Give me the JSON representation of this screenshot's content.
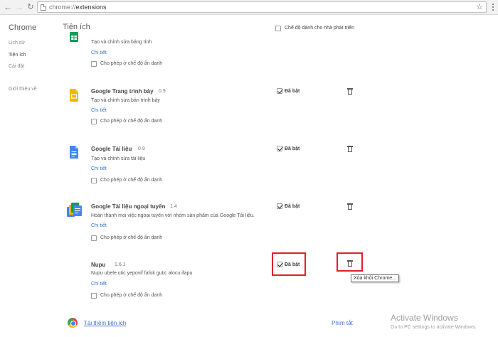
{
  "browser": {
    "url_scheme": "chrome://",
    "url_path": "extensions"
  },
  "sidebar": {
    "title": "Chrome",
    "items": [
      {
        "label": "Lịch sử"
      },
      {
        "label": "Tiện ích"
      },
      {
        "label": "Cài đặt"
      },
      {
        "label": "Giới thiệu về"
      }
    ]
  },
  "header": {
    "title": "Tiện ích",
    "dev_mode_label": "Chế độ dành cho nhà phát triển"
  },
  "extensions": [
    {
      "name": "",
      "version": "",
      "description": "Tạo và chỉnh sửa bảng tính",
      "details": "Chi tiết",
      "incognito": "Cho phép ở chế độ ẩn danh",
      "icon": "google-sheets-icon"
    },
    {
      "name": "Google Trang trình bày",
      "version": "0.9",
      "description": "Tạo và chỉnh sửa bản trình bày",
      "details": "Chi tiết",
      "incognito": "Cho phép ở chế độ ẩn danh",
      "enabled_label": "Đã bật",
      "icon": "google-slides-icon"
    },
    {
      "name": "Google Tài liệu",
      "version": "0.9",
      "description": "Tạo và chỉnh sửa tài liệu",
      "details": "Chi tiết",
      "incognito": "Cho phép ở chế độ ẩn danh",
      "enabled_label": "Đã bật",
      "icon": "google-docs-icon"
    },
    {
      "name": "Google Tài liệu ngoại tuyến",
      "version": "1.4",
      "description": "Hoàn thành mọi việc ngoại tuyến với nhóm sản phẩm của Google Tài liệu.",
      "details": "Chi tiết",
      "incognito": "Cho phép ở chế độ ẩn danh",
      "enabled_label": "Đã bật",
      "icon": "google-docs-offline-icon"
    },
    {
      "name": "Nupu",
      "version": "1.6.1",
      "description": "Nupu ubele utic yepovif fafok gutic alocu ifapu",
      "details": "Chi tiết",
      "incognito": "Cho phép ở chế độ ẩn danh",
      "enabled_label": "Đã bật",
      "icon": ""
    }
  ],
  "tooltip": "Xóa khỏi Chrome...",
  "footer": {
    "more_extensions": "Tải thêm tiện ích",
    "shortcuts": "Phím tắt"
  },
  "watermark": {
    "title": "Activate Windows",
    "subtitle": "Go to PC settings to activate Windows."
  },
  "colors": {
    "link": "#3b6fd4",
    "highlight": "#e0202a"
  }
}
